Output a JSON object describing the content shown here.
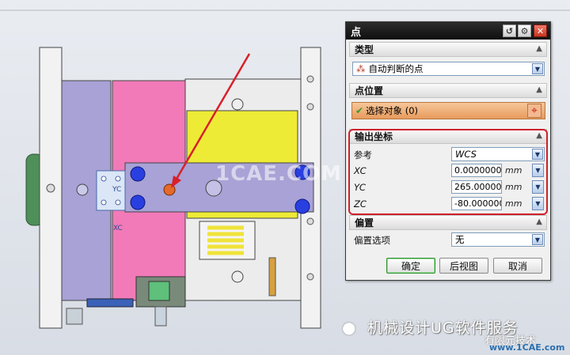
{
  "colors": {
    "accent_red": "#d0202a",
    "dialog_bg": "#f0f0f0",
    "title_bar": "#141414",
    "check_green": "#2f9e2f"
  },
  "canvas": {
    "label_yc": "YC",
    "label_xc": "XC",
    "watermark_site": "1CAE.COM"
  },
  "dialog": {
    "title": "点",
    "title_icons": [
      "reset-icon",
      "gear-icon",
      "close-icon"
    ],
    "type_section": {
      "header": "类型",
      "value": "自动判断的点",
      "icon": "point-infer-icon"
    },
    "location_section": {
      "header": "点位置",
      "select_label": "选择对象 (0)",
      "pick_icon": "crosshair-icon"
    },
    "output_section": {
      "header": "输出坐标",
      "reference_label": "参考",
      "reference_value": "WCS",
      "xc_label": "XC",
      "xc_value": "0.0000000",
      "xc_unit": "mm",
      "yc_label": "YC",
      "yc_value": "265.0000000",
      "yc_unit": "mm",
      "zc_label": "ZC",
      "zc_value": "-80.0000000",
      "zc_unit": "mm"
    },
    "offset_section": {
      "header": "偏置",
      "option_label": "偏置选项",
      "option_value": "无"
    },
    "buttons": {
      "ok": "确定",
      "back_view": "后视图",
      "cancel": "取消"
    }
  },
  "watermark": {
    "line1": "机械设计UG软件服务",
    "line2": "有限元技术",
    "line3": "www.1CAE.com"
  }
}
